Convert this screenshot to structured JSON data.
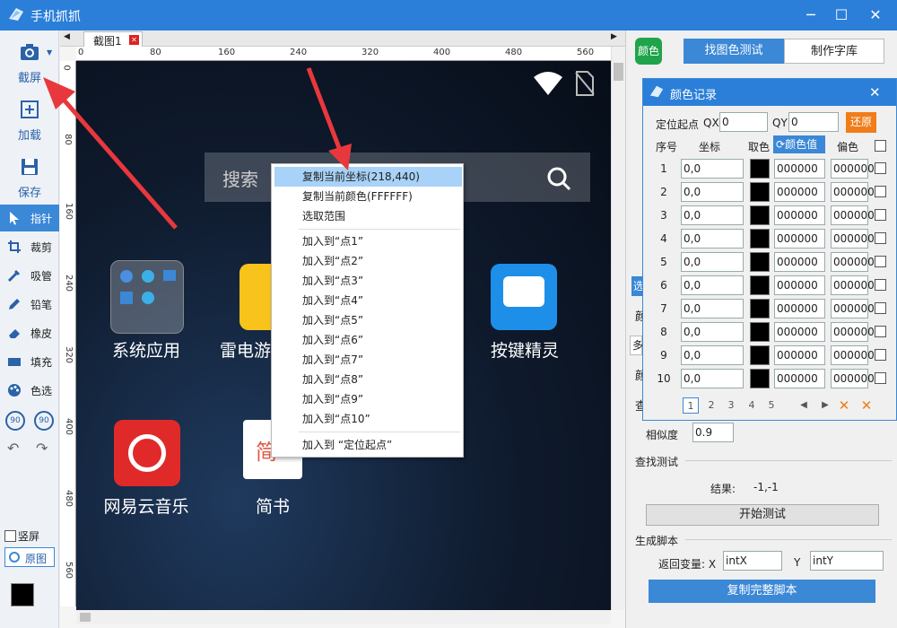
{
  "window": {
    "title": "手机抓抓",
    "min": "─",
    "max": "☐",
    "close": "✕"
  },
  "toolbar": {
    "screenshot": "截屏",
    "load": "加载",
    "save": "保存",
    "pointer": "指针",
    "crop": "裁剪",
    "picker": "吸管",
    "pencil": "铅笔",
    "eraser": "橡皮",
    "fill": "填充",
    "color": "色选",
    "rot_left": "90",
    "rot_right": "90",
    "portrait": "竖屏",
    "original": "原图"
  },
  "tab": {
    "label": "截图1"
  },
  "ruler": {
    "h": [
      "0",
      "80",
      "160",
      "240",
      "320",
      "400",
      "480",
      "560"
    ],
    "v": [
      "0",
      "80",
      "160",
      "240",
      "320",
      "400",
      "480",
      "560"
    ]
  },
  "phone": {
    "search_placeholder": "搜索",
    "apps": [
      {
        "label": "系统应用"
      },
      {
        "label": "雷电游"
      },
      {
        "label": "按键精灵"
      },
      {
        "label": "网易云音乐"
      },
      {
        "label": "简书"
      }
    ],
    "jianshu_glyph": "简"
  },
  "context_menu": {
    "items": [
      "复制当前坐标(218,440)",
      "复制当前颜色(FFFFFF)",
      "选取范围",
      "加入到“点1”",
      "加入到“点2”",
      "加入到“点3”",
      "加入到“点4”",
      "加入到“点5”",
      "加入到“点6”",
      "加入到“点7”",
      "加入到“点8”",
      "加入到“点9”",
      "加入到“点10”",
      "加入到 “定位起点”"
    ]
  },
  "right": {
    "color_btn": "颜色",
    "tab_find": "找图色测试",
    "tab_lib": "制作字库",
    "similarity_label": "相似度",
    "similarity_value": "0.9",
    "find_test": "查找测试",
    "result_label": "结果:",
    "result_value": "-1,-1",
    "start_test": "开始测试",
    "gen_script": "生成脚本",
    "return_var": "返回变量: X",
    "x_var": "intX",
    "y_label": "Y",
    "y_var": "intY",
    "copy_script": "复制完整脚本",
    "partial": [
      "选",
      "颜",
      "多",
      "颜",
      "查"
    ]
  },
  "dialog": {
    "title": "颜色记录",
    "close": "✕",
    "origin_label": "定位起点",
    "qx_label": "QX",
    "qx": "0",
    "qy_label": "QY",
    "qy": "0",
    "restore": "还原",
    "h_index": "序号",
    "h_coord": "坐标",
    "h_pick": "取色",
    "h_value": "颜色值",
    "h_offset": "偏色",
    "rows": [
      {
        "n": "1",
        "coord": "0,0",
        "val": "000000",
        "off": "000000"
      },
      {
        "n": "2",
        "coord": "0,0",
        "val": "000000",
        "off": "000000"
      },
      {
        "n": "3",
        "coord": "0,0",
        "val": "000000",
        "off": "000000"
      },
      {
        "n": "4",
        "coord": "0,0",
        "val": "000000",
        "off": "000000"
      },
      {
        "n": "5",
        "coord": "0,0",
        "val": "000000",
        "off": "000000"
      },
      {
        "n": "6",
        "coord": "0,0",
        "val": "000000",
        "off": "000000"
      },
      {
        "n": "7",
        "coord": "0,0",
        "val": "000000",
        "off": "000000"
      },
      {
        "n": "8",
        "coord": "0,0",
        "val": "000000",
        "off": "000000"
      },
      {
        "n": "9",
        "coord": "0,0",
        "val": "000000",
        "off": "000000"
      },
      {
        "n": "10",
        "coord": "0,0",
        "val": "000000",
        "off": "000000"
      }
    ],
    "pages": [
      "1",
      "2",
      "3",
      "4",
      "5"
    ]
  },
  "colors": {
    "accent": "#2b7fd9",
    "orange": "#f07d1a",
    "arrow": "#e8383d"
  }
}
